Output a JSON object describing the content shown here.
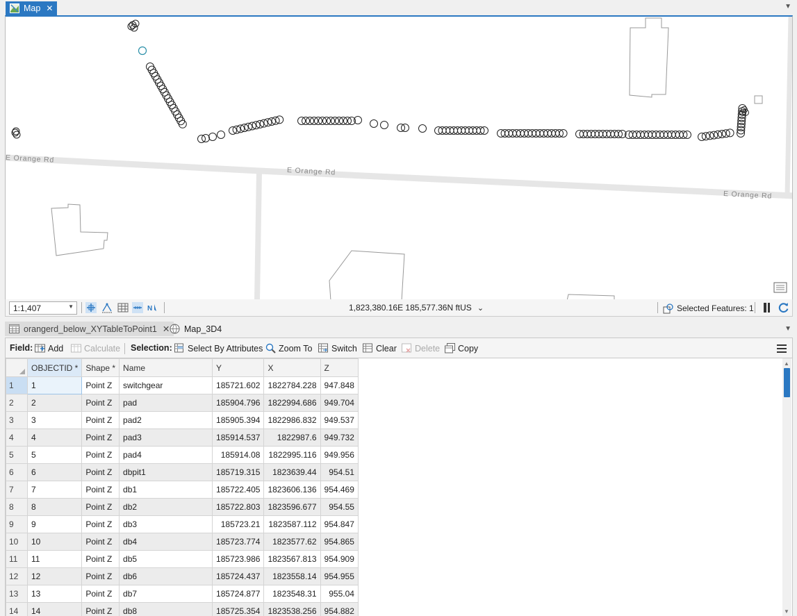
{
  "map_tab": {
    "label": "Map",
    "close": "✕"
  },
  "map": {
    "road_labels": [
      "E Orange Rd",
      "E Orange Rd",
      "E Orange Rd"
    ]
  },
  "map_status": {
    "scale": "1:1,407",
    "coordinates": "1,823,380.16E 185,577.36N ftUS",
    "selected_features": "Selected Features: 1"
  },
  "table_tabs": [
    {
      "label": "orangerd_below_XYTableToPoint1",
      "close": "✕"
    },
    {
      "label": "Map_3D4"
    }
  ],
  "table_toolbar": {
    "field_label": "Field:",
    "add": "Add",
    "calculate": "Calculate",
    "selection_label": "Selection:",
    "select_by_attributes": "Select By Attributes",
    "zoom_to": "Zoom To",
    "switch": "Switch",
    "clear": "Clear",
    "delete": "Delete",
    "copy": "Copy"
  },
  "table": {
    "columns": [
      "OBJECTID *",
      "Shape *",
      "Name",
      "Y",
      "X",
      "Z"
    ],
    "rows": [
      [
        "1",
        "1",
        "Point Z",
        "switchgear",
        "185721.602",
        "1822784.228",
        "947.848"
      ],
      [
        "2",
        "2",
        "Point Z",
        "pad",
        "185904.796",
        "1822994.686",
        "949.704"
      ],
      [
        "3",
        "3",
        "Point Z",
        "pad2",
        "185905.394",
        "1822986.832",
        "949.537"
      ],
      [
        "4",
        "4",
        "Point Z",
        "pad3",
        "185914.537",
        "1822987.6",
        "949.732"
      ],
      [
        "5",
        "5",
        "Point Z",
        "pad4",
        "185914.08",
        "1822995.116",
        "949.956"
      ],
      [
        "6",
        "6",
        "Point Z",
        "dbpit1",
        "185719.315",
        "1823639.44",
        "954.51"
      ],
      [
        "7",
        "7",
        "Point Z",
        "db1",
        "185722.405",
        "1823606.136",
        "954.469"
      ],
      [
        "8",
        "8",
        "Point Z",
        "db2",
        "185722.803",
        "1823596.677",
        "954.55"
      ],
      [
        "9",
        "9",
        "Point Z",
        "db3",
        "185723.21",
        "1823587.112",
        "954.847"
      ],
      [
        "10",
        "10",
        "Point Z",
        "db4",
        "185723.774",
        "1823577.62",
        "954.865"
      ],
      [
        "11",
        "11",
        "Point Z",
        "db5",
        "185723.986",
        "1823567.813",
        "954.909"
      ],
      [
        "12",
        "12",
        "Point Z",
        "db6",
        "185724.437",
        "1823558.14",
        "954.955"
      ],
      [
        "13",
        "13",
        "Point Z",
        "db7",
        "185724.877",
        "1823548.31",
        "955.04"
      ],
      [
        "14",
        "14",
        "Point Z",
        "db8",
        "185725.354",
        "1823538.256",
        "954.882"
      ]
    ]
  }
}
